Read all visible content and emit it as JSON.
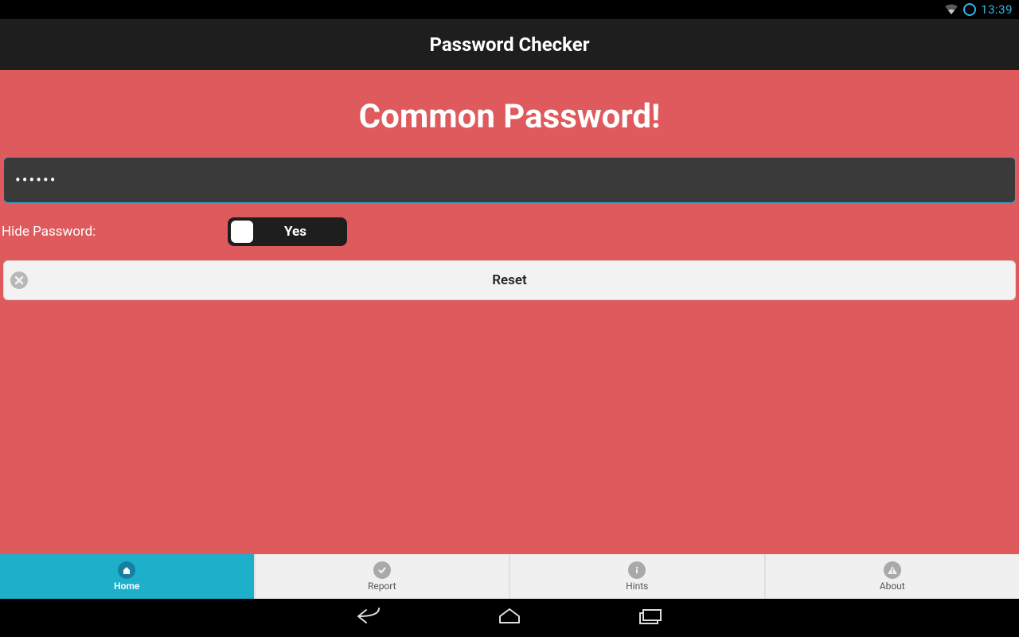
{
  "status": {
    "time": "13:39"
  },
  "actionbar": {
    "title": "Password Checker"
  },
  "main": {
    "heading": "Common Password!",
    "password_masked": "••••••",
    "hide_label": "Hide Password:",
    "toggle_value": "Yes",
    "reset_label": "Reset"
  },
  "tabs": {
    "home": "Home",
    "report": "Report",
    "hints": "Hints",
    "about": "About"
  }
}
